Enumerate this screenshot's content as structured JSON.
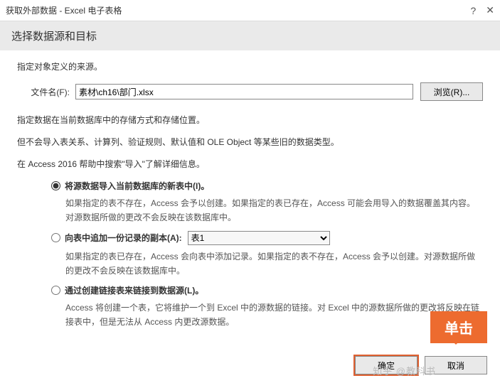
{
  "title": "获取外部数据 - Excel 电子表格",
  "section_title": "选择数据源和目标",
  "intro": "指定对象定义的来源。",
  "file": {
    "label": "文件名(F):",
    "value": "素材\\ch16\\部门.xlsx",
    "browse": "浏览(R)..."
  },
  "para1": "指定数据在当前数据库中的存储方式和存储位置。",
  "para2": "但不会导入表关系、计算列、验证规则、默认值和 OLE Object 等某些旧的数据类型。",
  "para3": "在 Access 2016 帮助中搜索\"导入\"了解详细信息。",
  "opt1": {
    "label": "将源数据导入当前数据库的新表中(I)。",
    "desc": "如果指定的表不存在，Access 会予以创建。如果指定的表已存在，Access 可能会用导入的数据覆盖其内容。对源数据所做的更改不会反映在该数据库中。"
  },
  "opt2": {
    "label": "向表中追加一份记录的副本(A):",
    "select": "表1",
    "desc": "如果指定的表已存在，Access 会向表中添加记录。如果指定的表不存在，Access 会予以创建。对源数据所做的更改不会反映在该数据库中。"
  },
  "opt3": {
    "label": "通过创建链接表来链接到数据源(L)。",
    "desc": "Access 将创建一个表，它将维护一个到 Excel 中的源数据的链接。对 Excel 中的源数据所做的更改将反映在链接表中，但是无法从 Access 内更改源数据。"
  },
  "footer": {
    "ok": "确定",
    "cancel": "取消"
  },
  "callout": "单击",
  "watermark": "知乎 @教科书"
}
